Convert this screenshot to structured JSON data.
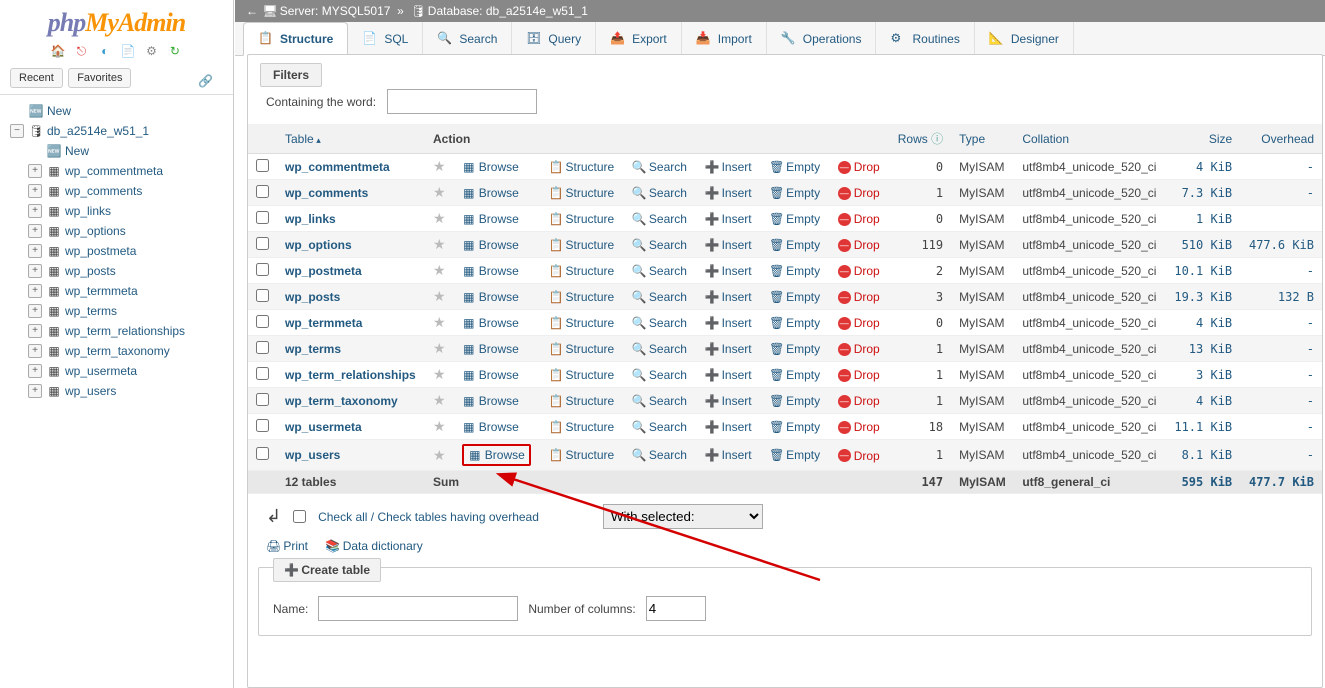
{
  "breadcrumb": {
    "server_label": "Server:",
    "server": "MYSQL5017",
    "db_label": "Database:",
    "db": "db_a2514e_w51_1"
  },
  "left": {
    "recent": "Recent",
    "favorites": "Favorites",
    "new": "New",
    "db": "db_a2514e_w51_1",
    "db_new": "New",
    "tables": [
      "wp_commentmeta",
      "wp_comments",
      "wp_links",
      "wp_options",
      "wp_postmeta",
      "wp_posts",
      "wp_termmeta",
      "wp_terms",
      "wp_term_relationships",
      "wp_term_taxonomy",
      "wp_usermeta",
      "wp_users"
    ]
  },
  "tabs": {
    "structure": "Structure",
    "sql": "SQL",
    "search": "Search",
    "query": "Query",
    "export": "Export",
    "import": "Import",
    "operations": "Operations",
    "routines": "Routines",
    "designer": "Designer"
  },
  "filters": {
    "legend": "Filters",
    "label": "Containing the word:",
    "value": ""
  },
  "columns": {
    "table": "Table",
    "action": "Action",
    "rows": "Rows",
    "type": "Type",
    "collation": "Collation",
    "size": "Size",
    "overhead": "Overhead"
  },
  "actions": {
    "browse": "Browse",
    "structure": "Structure",
    "search": "Search",
    "insert": "Insert",
    "empty": "Empty",
    "drop": "Drop"
  },
  "rows": [
    {
      "name": "wp_commentmeta",
      "rows": "0",
      "type": "MyISAM",
      "coll": "utf8mb4_unicode_520_ci",
      "size": "4 KiB",
      "ovr": "-"
    },
    {
      "name": "wp_comments",
      "rows": "1",
      "type": "MyISAM",
      "coll": "utf8mb4_unicode_520_ci",
      "size": "7.3 KiB",
      "ovr": "-"
    },
    {
      "name": "wp_links",
      "rows": "0",
      "type": "MyISAM",
      "coll": "utf8mb4_unicode_520_ci",
      "size": "1 KiB",
      "ovr": ""
    },
    {
      "name": "wp_options",
      "rows": "119",
      "type": "MyISAM",
      "coll": "utf8mb4_unicode_520_ci",
      "size": "510 KiB",
      "ovr": "477.6 KiB"
    },
    {
      "name": "wp_postmeta",
      "rows": "2",
      "type": "MyISAM",
      "coll": "utf8mb4_unicode_520_ci",
      "size": "10.1 KiB",
      "ovr": "-"
    },
    {
      "name": "wp_posts",
      "rows": "3",
      "type": "MyISAM",
      "coll": "utf8mb4_unicode_520_ci",
      "size": "19.3 KiB",
      "ovr": "132 B"
    },
    {
      "name": "wp_termmeta",
      "rows": "0",
      "type": "MyISAM",
      "coll": "utf8mb4_unicode_520_ci",
      "size": "4 KiB",
      "ovr": "-"
    },
    {
      "name": "wp_terms",
      "rows": "1",
      "type": "MyISAM",
      "coll": "utf8mb4_unicode_520_ci",
      "size": "13 KiB",
      "ovr": "-"
    },
    {
      "name": "wp_term_relationships",
      "rows": "1",
      "type": "MyISAM",
      "coll": "utf8mb4_unicode_520_ci",
      "size": "3 KiB",
      "ovr": "-"
    },
    {
      "name": "wp_term_taxonomy",
      "rows": "1",
      "type": "MyISAM",
      "coll": "utf8mb4_unicode_520_ci",
      "size": "4 KiB",
      "ovr": "-"
    },
    {
      "name": "wp_usermeta",
      "rows": "18",
      "type": "MyISAM",
      "coll": "utf8mb4_unicode_520_ci",
      "size": "11.1 KiB",
      "ovr": "-"
    },
    {
      "name": "wp_users",
      "rows": "1",
      "type": "MyISAM",
      "coll": "utf8mb4_unicode_520_ci",
      "size": "8.1 KiB",
      "ovr": "-",
      "highlight": true
    }
  ],
  "sum": {
    "count": "12 tables",
    "label": "Sum",
    "rows": "147",
    "type": "MyISAM",
    "coll": "utf8_general_ci",
    "size": "595 KiB",
    "ovr": "477.7 KiB"
  },
  "below": {
    "checkall": "Check all / Check tables having overhead",
    "withselected": "With selected:"
  },
  "links": {
    "print": "Print",
    "dict": "Data dictionary"
  },
  "create": {
    "legend": "Create table",
    "name": "Name:",
    "cols": "Number of columns:",
    "cols_val": "4"
  }
}
